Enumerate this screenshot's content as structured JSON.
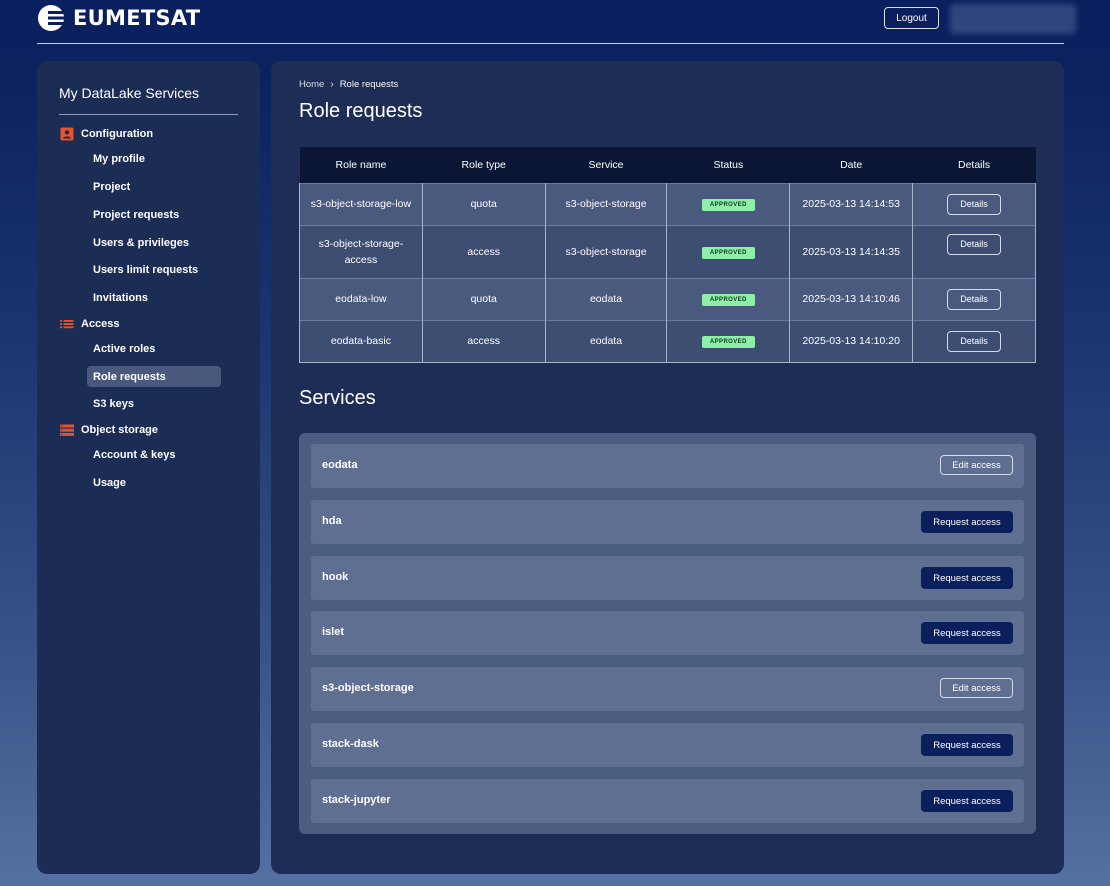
{
  "header": {
    "brand": "EUMETSAT",
    "logout_label": "Logout"
  },
  "sidebar": {
    "title": "My DataLake Services",
    "sections": [
      {
        "label": "Configuration",
        "icon": "user-card-icon",
        "items": [
          "My profile",
          "Project",
          "Project requests",
          "Users & privileges",
          "Users limit requests",
          "Invitations"
        ]
      },
      {
        "label": "Access",
        "icon": "list-icon",
        "items": [
          "Active roles",
          "Role requests",
          "S3 keys"
        ]
      },
      {
        "label": "Object storage",
        "icon": "storage-icon",
        "items": [
          "Account & keys",
          "Usage"
        ]
      }
    ],
    "active_item": "Role requests"
  },
  "breadcrumb": {
    "home": "Home",
    "current": "Role requests"
  },
  "page_title": "Role requests",
  "table": {
    "columns": [
      "Role name",
      "Role type",
      "Service",
      "Status",
      "Date",
      "Details"
    ],
    "rows": [
      {
        "role_name": "s3-object-storage-low",
        "role_type": "quota",
        "service": "s3-object-storage",
        "status": "APPROVED",
        "date": "2025-03-13 14:14:53",
        "details": "Details"
      },
      {
        "role_name": "s3-object-storage-access",
        "role_type": "access",
        "service": "s3-object-storage",
        "status": "APPROVED",
        "date": "2025-03-13 14:14:35",
        "details": "Details"
      },
      {
        "role_name": "eodata-low",
        "role_type": "quota",
        "service": "eodata",
        "status": "APPROVED",
        "date": "2025-03-13 14:10:46",
        "details": "Details"
      },
      {
        "role_name": "eodata-basic",
        "role_type": "access",
        "service": "eodata",
        "status": "APPROVED",
        "date": "2025-03-13 14:10:20",
        "details": "Details"
      }
    ]
  },
  "services_title": "Services",
  "services": [
    {
      "name": "eodata",
      "action": "Edit access"
    },
    {
      "name": "hda",
      "action": "Request access"
    },
    {
      "name": "hook",
      "action": "Request access"
    },
    {
      "name": "islet",
      "action": "Request access"
    },
    {
      "name": "s3-object-storage",
      "action": "Edit access"
    },
    {
      "name": "stack-dask",
      "action": "Request access"
    },
    {
      "name": "stack-jupyter",
      "action": "Request access"
    }
  ],
  "colors": {
    "accent_orange": "#e8532b",
    "badge_green": "#8ef0a8",
    "primary_button": "#0b1f5c"
  }
}
